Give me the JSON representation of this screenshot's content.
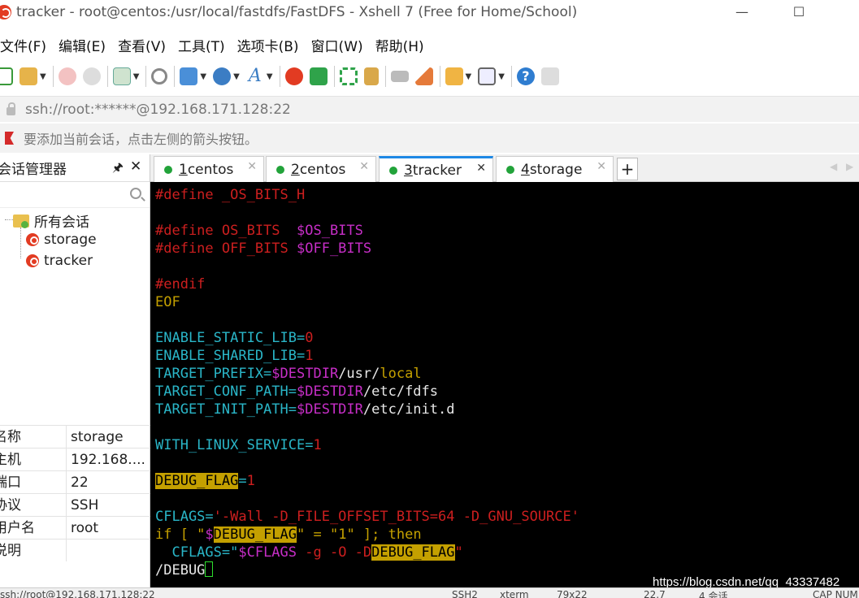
{
  "window": {
    "title": "tracker - root@centos:/usr/local/fastdfs/FastDFS - Xshell 7 (Free for Home/School)",
    "minimize": "—",
    "maximize": "☐"
  },
  "menu": [
    "文件(F)",
    "编辑(E)",
    "查看(V)",
    "工具(T)",
    "选项卡(B)",
    "窗口(W)",
    "帮助(H)"
  ],
  "address": {
    "url": "ssh://root:******@192.168.171.128:22"
  },
  "hint": {
    "text": "要添加当前会话，点击左侧的箭头按钮。"
  },
  "session_manager": {
    "title": "会话管理器",
    "pin": "🖈",
    "close": "✕",
    "root": "所有会话",
    "sessions": [
      "storage",
      "tracker"
    ],
    "properties": [
      {
        "key": "名称",
        "value": "storage"
      },
      {
        "key": "主机",
        "value": "192.168...."
      },
      {
        "key": "端口",
        "value": "22"
      },
      {
        "key": "协议",
        "value": "SSH"
      },
      {
        "key": "用户名",
        "value": "root"
      },
      {
        "key": "说明",
        "value": ""
      }
    ]
  },
  "tabs": [
    {
      "num": "1",
      "name": " centos"
    },
    {
      "num": "2",
      "name": " centos"
    },
    {
      "num": "3",
      "name": " tracker"
    },
    {
      "num": "4",
      "name": " storage"
    }
  ],
  "tab_close": "✕",
  "tab_add": "+",
  "terminal": {
    "l1": "#define _OS_BITS_H",
    "l2a": "#define OS_BITS  ",
    "l2b": "$OS_BITS",
    "l3a": "#define OFF_BITS ",
    "l3b": "$OFF_BITS",
    "l4": "#endif",
    "l5": "EOF",
    "l6a": "ENABLE_STATIC_LIB=",
    "l6b": "0",
    "l7a": "ENABLE_SHARED_LIB=",
    "l7b": "1",
    "l8a": "TARGET_PREFIX=",
    "l8b": "$DESTDIR",
    "l8c": "/usr/",
    "l8d": "local",
    "l9a": "TARGET_CONF_PATH=",
    "l9b": "$DESTDIR",
    "l9c": "/etc/fdfs",
    "l10a": "TARGET_INIT_PATH=",
    "l10b": "$DESTDIR",
    "l10c": "/etc/init.d",
    "l11a": "WITH_LINUX_SERVICE=",
    "l11b": "1",
    "l12a": "DEBUG_FLAG",
    "l12b": "=",
    "l12c": "1",
    "l13a": "CFLAGS=",
    "l13b": "'-Wall -D_FILE_OFFSET_BITS=64 -D_GNU_SOURCE'",
    "l14a": "if [ \"",
    "l14b": "$",
    "l14c": "DEBUG_FLAG",
    "l14d": "\" = \"1\" ]; then",
    "l15a": "  CFLAGS=\"",
    "l15b": "$CFLAGS",
    "l15c": " -g -O -D",
    "l15d": "DEBUG_FLAG",
    "l15e": "\"",
    "l16": "/DEBUG"
  },
  "watermark": "https://blog.csdn.net/qq_43337482",
  "status": {
    "left": "ssh://root@192.168.171.128:22",
    "ssh": "SSH2",
    "term": "xterm",
    "size": "79x22",
    "pos": "22,7",
    "sessions": "4 会话",
    "cap": "CAP NUM"
  },
  "colors": {
    "accent": "#1e88e5",
    "terminal_bg": "#000000",
    "highlight": "#c4a000"
  }
}
